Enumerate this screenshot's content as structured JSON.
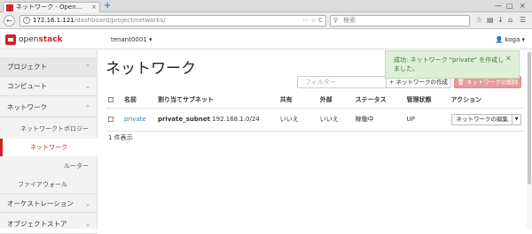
{
  "browser": {
    "tab_title": "ネットワーク - Open...",
    "tab_close": "×",
    "new_tab": "+",
    "window_controls": [
      "—",
      "□",
      "×"
    ],
    "url_host": "172.16.1.121",
    "url_path": "/dashboard/project/networks/",
    "url_tools": "⋯ ☆ C",
    "search_placeholder": "検索",
    "toolbar_icons": [
      "bookmark-star-icon",
      "bookmarks-icon",
      "downloads-icon",
      "home-icon",
      "menu-icon"
    ]
  },
  "header": {
    "logo_open": "open",
    "logo_stack": "stack",
    "project": "tenant0001 ▾",
    "user": "👤 koga ▾"
  },
  "sidebar": {
    "sections": [
      {
        "label": "プロジェクト",
        "chev": "⌃"
      },
      {
        "label": "コンピュート",
        "chev": "⌄"
      },
      {
        "label": "ネットワーク",
        "chev": "⌃"
      },
      {
        "label": "オーケストレーション",
        "chev": "⌄"
      },
      {
        "label": "オブジェクトストア",
        "chev": "⌄"
      }
    ],
    "items": [
      "ネットワークトポロジー",
      "ネットワーク",
      "ルーター",
      "ファイアウォール"
    ]
  },
  "main": {
    "title": "ネットワーク",
    "filter_placeholder": "フィルター",
    "create_label": "+ ネットワークの作成",
    "delete_label": "🗑 ネットワークの削除",
    "columns": [
      "名前",
      "割り当てサブネット",
      "共有",
      "外部",
      "ステータス",
      "管理状態",
      "アクション"
    ],
    "rows": [
      {
        "name": "private",
        "subnet_name": "private_subnet",
        "subnet_cidr": "192.168.1.0/24",
        "shared": "いいえ",
        "external": "いいえ",
        "status": "稼働中",
        "admin_state": "UP",
        "action": "ネットワークの編集"
      }
    ],
    "count": "1 件表示"
  },
  "toast": {
    "line1": "成功: ネットワーク \"private\" を作成し",
    "line2": "ました。",
    "close": "✕"
  }
}
